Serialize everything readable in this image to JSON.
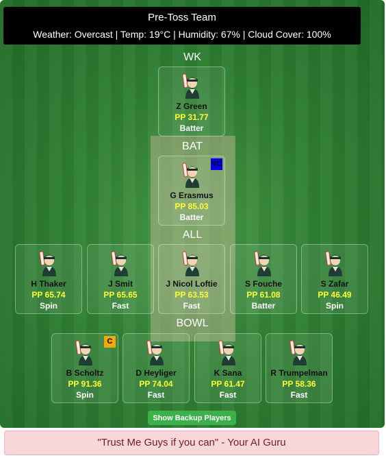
{
  "header": {
    "title": "Pre-Toss Team",
    "weather": "Weather: Overcast | Temp: 19°C | Humidity: 67% | Cloud Cover: 100%"
  },
  "sections": {
    "wk": "WK",
    "bat": "BAT",
    "all": "ALL",
    "bowl": "BOWL"
  },
  "players": {
    "wk": [
      {
        "name": "Z Green",
        "pp": "PP 31.77",
        "role": "Batter",
        "badge": ""
      }
    ],
    "bat": [
      {
        "name": "G Erasmus",
        "pp": "PP 85.03",
        "role": "Batter",
        "badge": "VC"
      }
    ],
    "all": [
      {
        "name": "H Thaker",
        "pp": "PP 65.74",
        "role": "Spin",
        "badge": ""
      },
      {
        "name": "J Smit",
        "pp": "PP 65.65",
        "role": "Fast",
        "badge": ""
      },
      {
        "name": "J Nicol Loftie",
        "pp": "PP 63.53",
        "role": "Fast",
        "badge": ""
      },
      {
        "name": "S Fouche",
        "pp": "PP 61.08",
        "role": "Batter",
        "badge": ""
      },
      {
        "name": "S Zafar",
        "pp": "PP 46.49",
        "role": "Spin",
        "badge": ""
      }
    ],
    "bowl": [
      {
        "name": "B Scholtz",
        "pp": "PP 91.36",
        "role": "Spin",
        "badge": "C"
      },
      {
        "name": "D Heyliger",
        "pp": "PP 74.04",
        "role": "Fast",
        "badge": ""
      },
      {
        "name": "K Sana",
        "pp": "PP 61.47",
        "role": "Fast",
        "badge": ""
      },
      {
        "name": "R Trumpelman",
        "pp": "PP 58.36",
        "role": "Fast",
        "badge": ""
      }
    ]
  },
  "backup_button": "Show Backup Players",
  "footer": "\"Trust Me Guys if you can\" - Your AI Guru",
  "icons": {
    "player_avatar": "cricket-player-avatar-icon"
  },
  "colors": {
    "pp_text": "#ffff33",
    "vc_badge": "#0000ee",
    "c_badge": "#f5a800",
    "button": "#3bb04b"
  }
}
